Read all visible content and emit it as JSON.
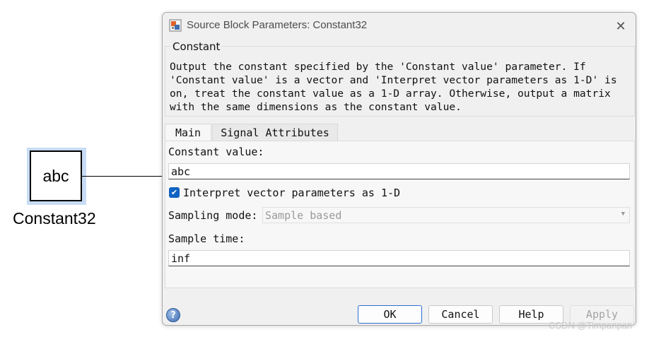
{
  "canvas": {
    "block_text": "abc",
    "block_name": "Constant32"
  },
  "dialog": {
    "title": "Source Block Parameters: Constant32",
    "close_glyph": "✕",
    "group_title": "Constant",
    "description": "Output the constant specified by the 'Constant value' parameter. If\n'Constant value' is a vector and 'Interpret vector parameters as 1-D' is\non, treat the constant value as a 1-D array. Otherwise, output a matrix\nwith the same dimensions as the constant value.",
    "tabs": [
      {
        "label": "Main",
        "active": true
      },
      {
        "label": "Signal Attributes",
        "active": false
      }
    ],
    "main": {
      "constant_value_label": "Constant value:",
      "constant_value": "abc",
      "interpret_checkbox_label": "Interpret vector parameters as 1-D",
      "interpret_checked": true,
      "sampling_mode_label": "Sampling mode:",
      "sampling_mode_value": "Sample based",
      "sample_time_label": "Sample time:",
      "sample_time_value": "inf"
    },
    "buttons": {
      "help_icon": "?",
      "ok": "OK",
      "cancel": "Cancel",
      "help": "Help",
      "apply": "Apply"
    }
  },
  "watermark": "CSDN @Timpanpan",
  "colors": {
    "accent": "#0f63c2",
    "block_highlight": "#c7dcf4"
  },
  "icons": {
    "title_icon": "block-parameters-icon",
    "checkbox": "check-icon",
    "help": "help-question-icon",
    "dropdown": "chevron-down-icon"
  }
}
